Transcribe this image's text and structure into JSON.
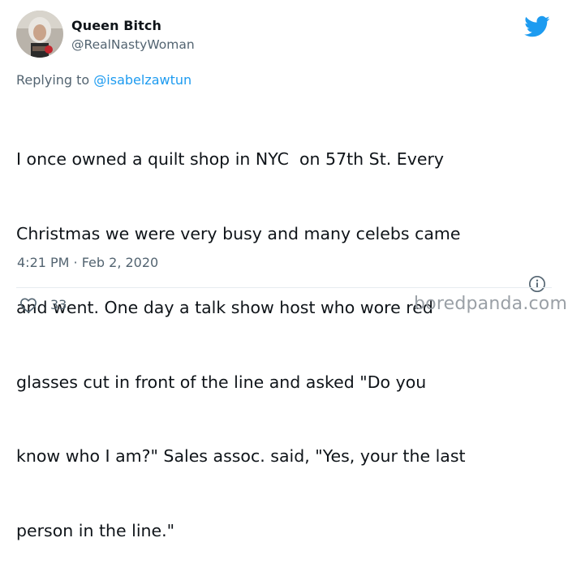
{
  "author": {
    "display_name": "Queen Bitch",
    "handle": "@RealNastyWoman"
  },
  "reply": {
    "prefix": "Replying to ",
    "mention": "@isabelzawtun"
  },
  "tweet": {
    "lines": [
      "I once owned a quilt shop in NYC  on 57th St. Every",
      "Christmas we were very busy and many celebs came",
      "and went. One day a talk show host who wore red",
      "glasses cut in front of the line and asked \"Do you",
      "know who I am?\" Sales assoc. said, \"Yes, your the last",
      "person in the line.\""
    ],
    "timestamp": "4:21 PM · Feb 2, 2020"
  },
  "actions": {
    "like_count": "33"
  },
  "watermark": "boredpanda.com",
  "colors": {
    "brand_blue": "#1d9bf0",
    "secondary_text": "#536471",
    "primary_text": "#0f1419"
  },
  "icons": [
    "twitter-bird-icon",
    "info-icon",
    "heart-icon"
  ]
}
